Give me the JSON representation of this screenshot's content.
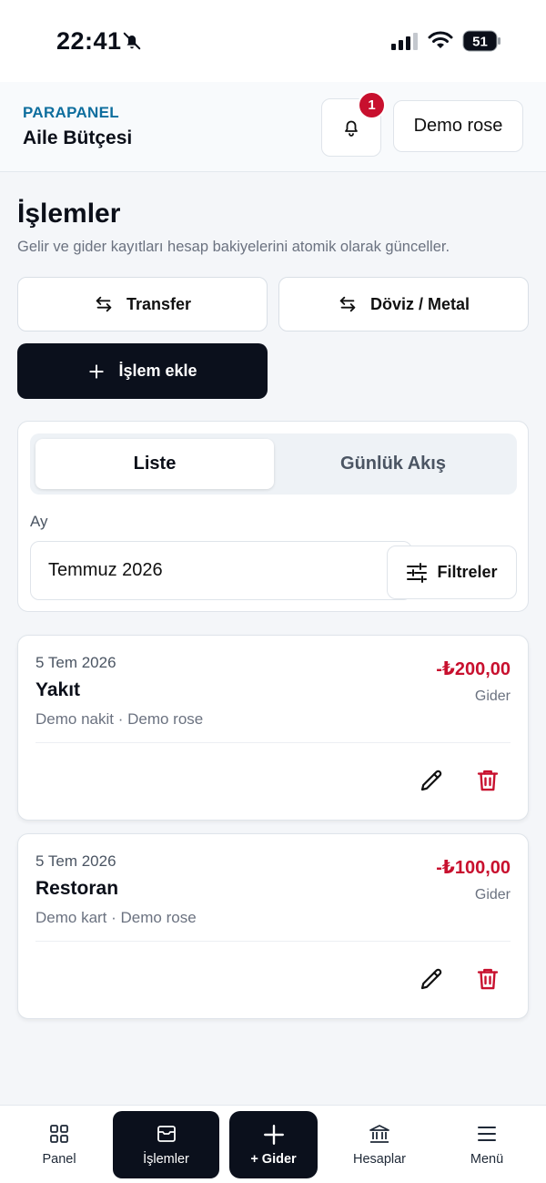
{
  "status_bar": {
    "time": "22:41",
    "battery": "51"
  },
  "header": {
    "brand": "PARAPANEL",
    "subtitle": "Aile Bütçesi",
    "notification_count": "1",
    "user": "Demo rose"
  },
  "page": {
    "title": "İşlemler",
    "subtitle": "Gelir ve gider kayıtları hesap bakiyelerini atomik olarak günceller.",
    "transfer_label": "Transfer",
    "fx_label": "Döviz / Metal",
    "add_label": "İşlem ekle"
  },
  "filter": {
    "tabs": [
      {
        "label": "Liste",
        "active": true
      },
      {
        "label": "Günlük Akış",
        "active": false
      }
    ],
    "month_label": "Ay",
    "month_value": "Temmuz 2026",
    "filters_label": "Filtreler"
  },
  "transactions": [
    {
      "date": "5 Tem 2026",
      "title": "Yakıt",
      "meta": "Demo nakit · Demo rose",
      "amount": "-₺200,00",
      "type": "Gider"
    },
    {
      "date": "5 Tem 2026",
      "title": "Restoran",
      "meta": "Demo kart · Demo rose",
      "amount": "-₺100,00",
      "type": "Gider"
    }
  ],
  "nav": {
    "items": [
      {
        "label": "Panel",
        "icon": "grid-icon"
      },
      {
        "label": "İşlemler",
        "icon": "wallet-icon",
        "active": true
      },
      {
        "label": "+ Gider",
        "icon": "plus-icon"
      },
      {
        "label": "Hesaplar",
        "icon": "bank-icon"
      },
      {
        "label": "Menü",
        "icon": "menu-icon"
      }
    ]
  },
  "colors": {
    "brand": "#0e6e9e",
    "primary": "#0b101c",
    "danger": "#c8102e"
  }
}
